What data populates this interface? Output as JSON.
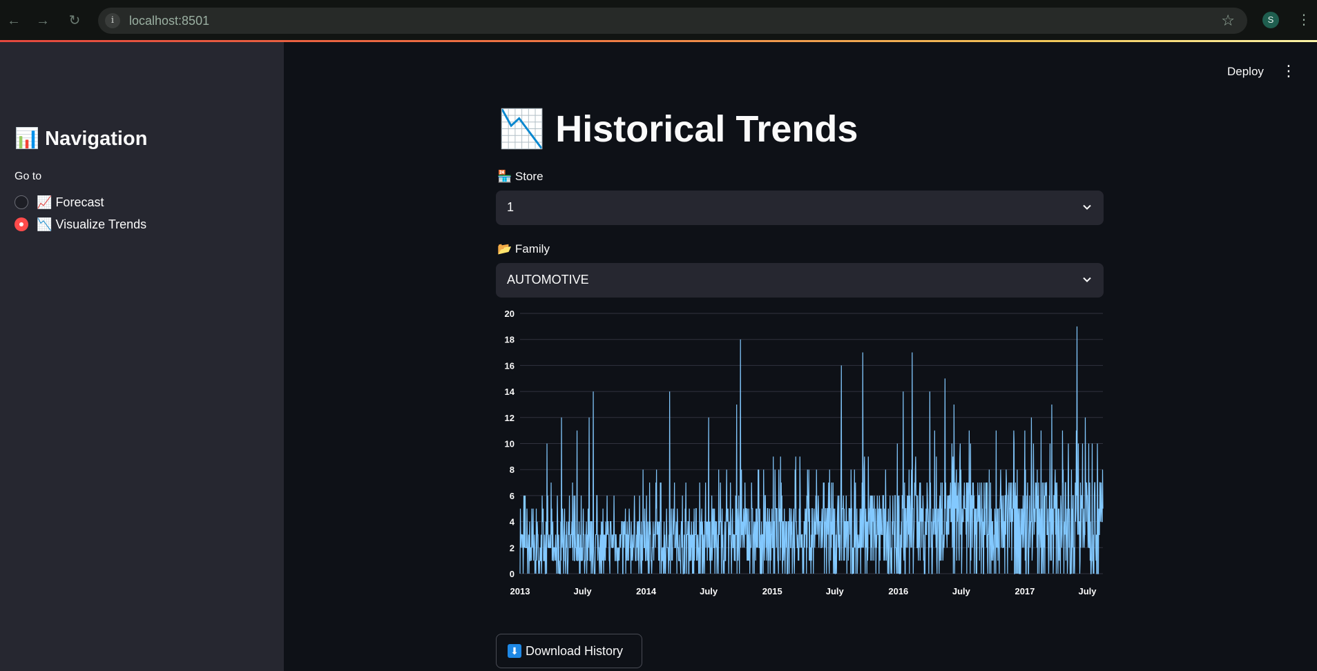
{
  "browser": {
    "url": "localhost:8501",
    "profile_initial": "S"
  },
  "sidebar": {
    "title_emoji": "📊",
    "title": "Navigation",
    "goto_label": "Go to",
    "options": [
      {
        "emoji": "📈",
        "label": "Forecast",
        "selected": false
      },
      {
        "emoji": "📉",
        "label": "Visualize Trends",
        "selected": true
      }
    ]
  },
  "header": {
    "deploy_label": "Deploy"
  },
  "main": {
    "title_emoji": "📉",
    "title": "Historical Trends",
    "store": {
      "emoji": "🏪",
      "label": "Store",
      "value": "1"
    },
    "family": {
      "emoji": "📂",
      "label": "Family",
      "value": "AUTOMOTIVE"
    },
    "download": {
      "emoji": "⬇",
      "label": "Download History"
    }
  },
  "colors": {
    "accent": "#ff4b4b",
    "series": "#83c9ff",
    "sidebar_bg": "#262730",
    "main_bg": "#0e1117"
  },
  "chart_data": {
    "type": "line",
    "title": "",
    "xlabel": "",
    "ylabel": "",
    "ylim": [
      0,
      20
    ],
    "yticks": [
      0,
      2,
      4,
      6,
      8,
      10,
      12,
      14,
      16,
      18,
      20
    ],
    "x_start": "2013-01-01",
    "x_end": "2017-08-15",
    "xticks": [
      {
        "label": "2013",
        "date": "2013-01-01"
      },
      {
        "label": "July",
        "date": "2013-07-01"
      },
      {
        "label": "2014",
        "date": "2014-01-01"
      },
      {
        "label": "July",
        "date": "2014-07-01"
      },
      {
        "label": "2015",
        "date": "2015-01-01"
      },
      {
        "label": "July",
        "date": "2015-07-01"
      },
      {
        "label": "2016",
        "date": "2016-01-01"
      },
      {
        "label": "July",
        "date": "2016-07-01"
      },
      {
        "label": "2017",
        "date": "2017-01-01"
      },
      {
        "label": "July",
        "date": "2017-07-01"
      }
    ],
    "grid": true,
    "series": [
      {
        "baseline": [
          {
            "date": "2013-01-01",
            "value": 2
          },
          {
            "date": "2013-07-01",
            "value": 2
          },
          {
            "date": "2014-01-01",
            "value": 2.5
          },
          {
            "date": "2014-07-01",
            "value": 2.5
          },
          {
            "date": "2015-01-01",
            "value": 3
          },
          {
            "date": "2015-07-01",
            "value": 3
          },
          {
            "date": "2016-01-01",
            "value": 3.5
          },
          {
            "date": "2016-07-01",
            "value": 4
          },
          {
            "date": "2017-01-01",
            "value": 4
          },
          {
            "date": "2017-07-01",
            "value": 4
          }
        ],
        "peaks": [
          {
            "date": "2013-03-20",
            "value": 10
          },
          {
            "date": "2013-05-01",
            "value": 12
          },
          {
            "date": "2013-06-15",
            "value": 11
          },
          {
            "date": "2013-07-20",
            "value": 12
          },
          {
            "date": "2013-08-01",
            "value": 14
          },
          {
            "date": "2014-03-10",
            "value": 14
          },
          {
            "date": "2014-07-01",
            "value": 12
          },
          {
            "date": "2014-09-20",
            "value": 13
          },
          {
            "date": "2014-10-01",
            "value": 18
          },
          {
            "date": "2015-07-20",
            "value": 16
          },
          {
            "date": "2015-09-20",
            "value": 17
          },
          {
            "date": "2016-01-15",
            "value": 14
          },
          {
            "date": "2016-02-10",
            "value": 17
          },
          {
            "date": "2016-04-01",
            "value": 14
          },
          {
            "date": "2016-05-15",
            "value": 15
          },
          {
            "date": "2016-06-10",
            "value": 13
          },
          {
            "date": "2017-01-20",
            "value": 12
          },
          {
            "date": "2017-03-20",
            "value": 13
          },
          {
            "date": "2017-06-01",
            "value": 19
          },
          {
            "date": "2017-06-25",
            "value": 12
          },
          {
            "date": "2017-07-15",
            "value": 10
          }
        ]
      }
    ]
  }
}
